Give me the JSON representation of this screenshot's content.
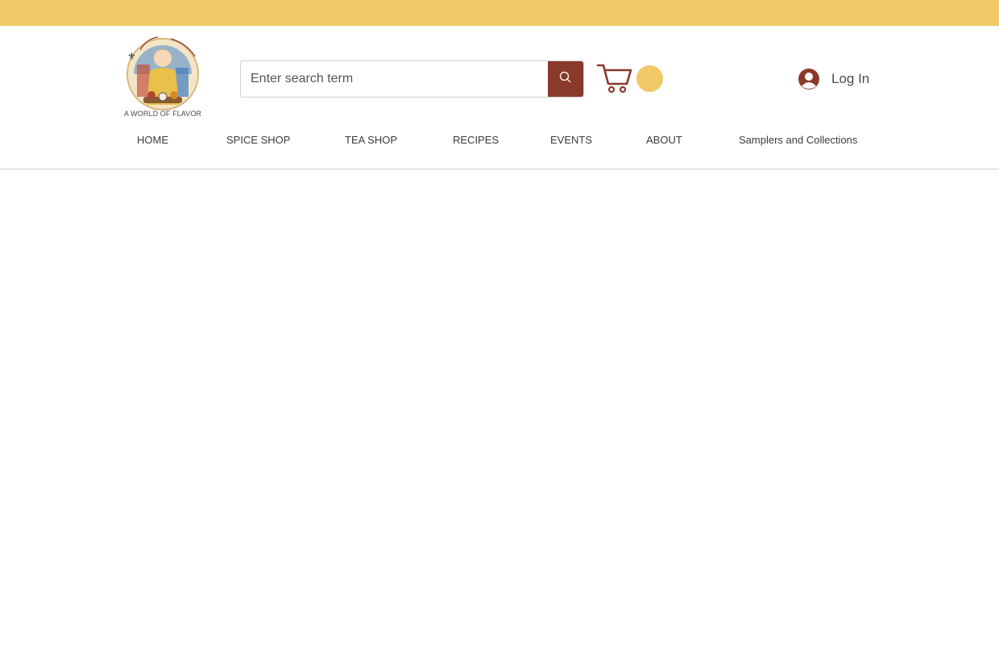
{
  "colors": {
    "top_bar": "#f0c865",
    "search_button": "#8a3a2a",
    "cart_icon": "#8a3a2a",
    "cart_badge": "#f0c865",
    "avatar": "#8a3a2a",
    "nav_text": "#3a3a42"
  },
  "header": {
    "logo_icon": "spice-shop-logo-icon",
    "logo_tagline": "A WORLD OF FLAVOR",
    "search": {
      "placeholder": "Enter search term",
      "button_icon": "search-icon"
    },
    "cart": {
      "icon": "cart-icon"
    },
    "login": {
      "icon": "user-avatar-icon",
      "label": "Log In"
    }
  },
  "nav": {
    "items": [
      {
        "label": "HOME"
      },
      {
        "label": "SPICE SHOP"
      },
      {
        "label": "TEA SHOP"
      },
      {
        "label": "RECIPES"
      },
      {
        "label": "EVENTS"
      },
      {
        "label": "ABOUT"
      },
      {
        "label": "Samplers and Collections"
      }
    ]
  }
}
